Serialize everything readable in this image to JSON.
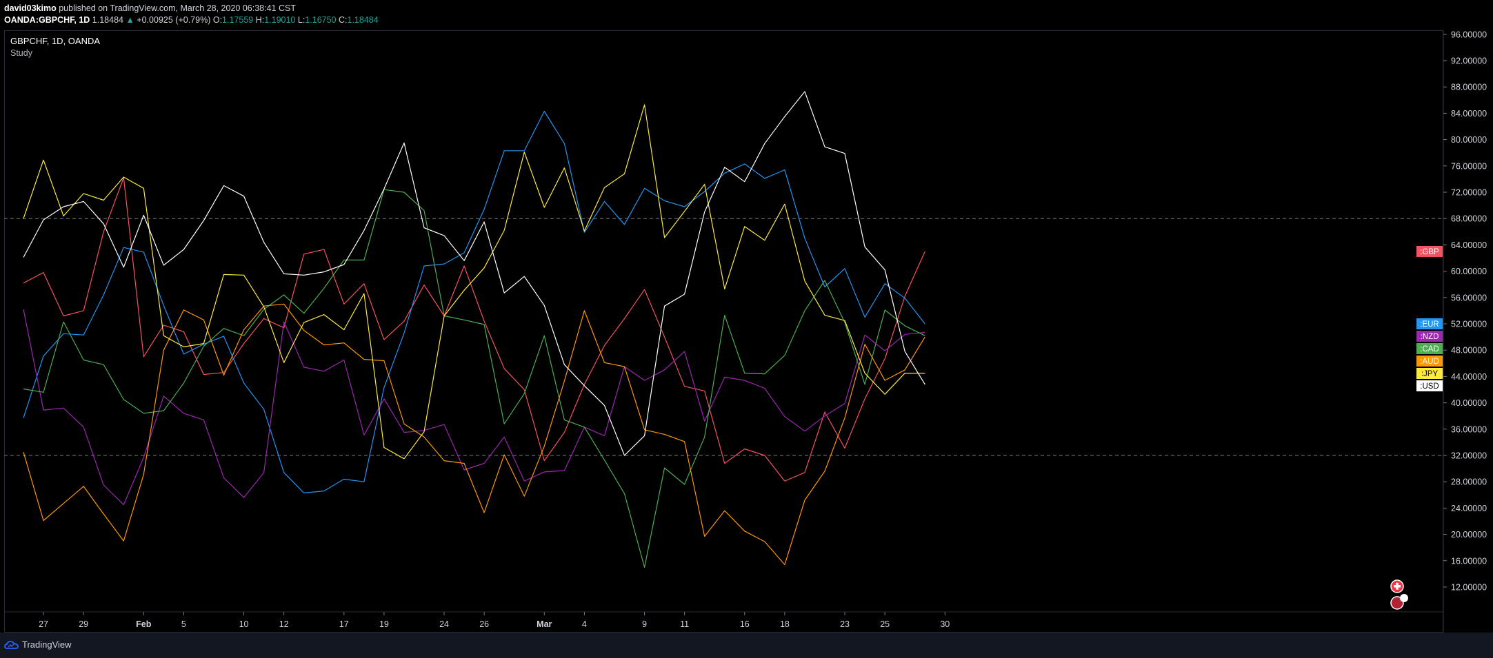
{
  "header": {
    "author": "david03kimo",
    "published_text": "published on TradingView.com, March 28, 2020 06:38:41 CST",
    "symbol": "OANDA:GBPCHF, 1D",
    "last": "1.18484",
    "arrow": "▲",
    "change": "+0.00925 (+0.79%)",
    "o_label": "O:",
    "o_value": "1.17559",
    "h_label": "H:",
    "h_value": "1.19010",
    "l_label": "L:",
    "l_value": "1.16750",
    "c_label": "C:",
    "c_value": "1.18484"
  },
  "legend": {
    "symbol": "GBPCHF, 1D, OANDA",
    "study": "Study"
  },
  "footer": {
    "brand": "TradingView"
  },
  "chart_data": {
    "type": "line",
    "title": "",
    "ylim": [
      8,
      96
    ],
    "y_ticks": [
      12,
      16,
      20,
      24,
      28,
      32,
      36,
      40,
      44,
      48,
      52,
      56,
      60,
      64,
      68,
      72,
      76,
      80,
      84,
      88,
      92,
      96
    ],
    "y_tick_labels": [
      "12.00000",
      "16.00000",
      "20.00000",
      "24.00000",
      "28.00000",
      "32.00000",
      "36.00000",
      "40.00000",
      "44.00000",
      "48.00000",
      "52.00000",
      "56.00000",
      "60.00000",
      "64.00000",
      "68.00000",
      "72.00000",
      "76.00000",
      "80.00000",
      "84.00000",
      "88.00000",
      "92.00000",
      "96.00000"
    ],
    "x_tick_indices": [
      1,
      3,
      6,
      8,
      11,
      13,
      16,
      18,
      21,
      23,
      26,
      28,
      31,
      33,
      36,
      38,
      41,
      43,
      46
    ],
    "x_tick_labels": [
      "27",
      "29",
      "Feb",
      "5",
      "10",
      "12",
      "17",
      "19",
      "24",
      "26",
      "Mar",
      "4",
      "9",
      "11",
      "16",
      "18",
      "23",
      "25",
      "30"
    ],
    "levels": [
      68,
      32
    ],
    "grid": false,
    "legend_position": "right-axis",
    "series": [
      {
        "name": ":GBP",
        "color": "#f7525f",
        "last": 63.0,
        "values": [
          58.2,
          59.8,
          53.2,
          54.0,
          66.0,
          74.2,
          47.0,
          51.8,
          50.8,
          44.3,
          44.6,
          49.0,
          52.8,
          51.4,
          62.6,
          63.3,
          55.0,
          58.1,
          49.6,
          52.4,
          57.9,
          53.2,
          60.8,
          52.4,
          45.2,
          42.0,
          31.2,
          35.5,
          42.8,
          48.7,
          52.8,
          57.2,
          50.0,
          42.5,
          41.8,
          30.8,
          33.0,
          32.0,
          28.1,
          29.4,
          38.6,
          33.1,
          40.6,
          46.7,
          56.2,
          63.0
        ]
      },
      {
        "name": ":EUR",
        "color": "#2196f3",
        "last": 52.0,
        "values": [
          37.7,
          47.1,
          50.5,
          50.3,
          56.4,
          63.6,
          62.9,
          54.8,
          47.4,
          48.9,
          50.1,
          43.0,
          39.0,
          29.4,
          26.3,
          26.6,
          28.4,
          28.0,
          42.3,
          50.6,
          60.8,
          61.1,
          62.8,
          69.4,
          78.3,
          78.3,
          84.3,
          79.4,
          65.9,
          70.6,
          67.1,
          72.6,
          70.7,
          69.8,
          72.1,
          74.9,
          76.3,
          74.1,
          75.4,
          65.0,
          57.6,
          60.4,
          53.0,
          58.1,
          55.9,
          52.0
        ]
      },
      {
        "name": ":NZD",
        "color": "#9c27b0",
        "last": 50.7,
        "values": [
          54.2,
          38.9,
          39.2,
          36.3,
          27.5,
          24.5,
          31.7,
          41.0,
          38.4,
          37.4,
          28.6,
          25.6,
          29.4,
          52.3,
          45.4,
          44.8,
          46.5,
          35.1,
          40.6,
          35.5,
          35.8,
          36.7,
          29.8,
          30.8,
          34.8,
          28.1,
          29.5,
          29.7,
          36.3,
          35.0,
          45.5,
          43.4,
          45.0,
          47.8,
          37.2,
          43.9,
          43.4,
          42.2,
          37.9,
          35.7,
          38.0,
          39.9,
          50.3,
          47.9,
          50.4,
          50.7
        ]
      },
      {
        "name": ":CAD",
        "color": "#4caf50",
        "last": 50.2,
        "values": [
          42.1,
          41.6,
          52.3,
          46.5,
          45.8,
          40.5,
          38.4,
          38.8,
          43.0,
          48.6,
          51.3,
          50.2,
          54.2,
          56.4,
          53.6,
          57.4,
          61.7,
          61.7,
          72.4,
          72.0,
          69.2,
          53.2,
          52.6,
          51.9,
          36.8,
          41.4,
          50.2,
          37.4,
          36.3,
          31.3,
          26.2,
          15.0,
          30.1,
          27.6,
          34.8,
          53.3,
          44.5,
          44.4,
          47.2,
          54.0,
          58.6,
          52.2,
          42.8,
          54.1,
          51.7,
          50.2
        ]
      },
      {
        "name": ":AUD",
        "color": "#ff9800",
        "last": 50.0,
        "values": [
          32.5,
          22.1,
          24.7,
          27.3,
          23.1,
          19.0,
          29.1,
          48.0,
          54.1,
          52.6,
          44.2,
          51.1,
          54.7,
          55.0,
          51.0,
          48.8,
          49.1,
          46.6,
          46.4,
          36.8,
          34.8,
          31.2,
          30.8,
          23.3,
          32.1,
          25.8,
          33.4,
          43.3,
          54.0,
          46.1,
          45.5,
          35.9,
          35.2,
          34.1,
          19.7,
          23.6,
          20.5,
          18.9,
          15.4,
          25.2,
          29.6,
          37.7,
          48.9,
          43.4,
          45.0,
          50.0
        ]
      },
      {
        "name": ":JPY",
        "color": "#ffeb3b",
        "last": 44.5,
        "values": [
          68.0,
          76.9,
          68.4,
          71.8,
          70.8,
          74.3,
          72.6,
          50.2,
          48.5,
          49.0,
          59.5,
          59.4,
          54.6,
          46.1,
          52.2,
          53.4,
          51.1,
          56.6,
          33.2,
          31.5,
          35.6,
          53.2,
          57.1,
          60.5,
          66.2,
          78.1,
          69.7,
          75.7,
          66.1,
          72.7,
          74.8,
          85.3,
          65.1,
          69.1,
          73.2,
          57.3,
          66.8,
          64.7,
          70.2,
          58.5,
          53.3,
          52.5,
          44.5,
          41.3,
          44.5,
          44.5
        ]
      },
      {
        "name": ":USD",
        "color": "#ffffff",
        "last": 42.8,
        "values": [
          62.1,
          67.8,
          69.8,
          70.6,
          67.2,
          60.6,
          68.5,
          60.9,
          63.3,
          67.7,
          73.0,
          71.4,
          64.4,
          59.6,
          59.4,
          59.9,
          61.0,
          66.2,
          72.5,
          79.5,
          66.6,
          65.4,
          61.6,
          67.5,
          56.7,
          59.2,
          54.8,
          45.8,
          42.6,
          39.6,
          32.0,
          35.0,
          54.7,
          56.5,
          69.0,
          75.8,
          73.6,
          79.4,
          83.5,
          87.3,
          78.9,
          77.9,
          63.7,
          60.2,
          47.8,
          42.8
        ]
      }
    ]
  }
}
